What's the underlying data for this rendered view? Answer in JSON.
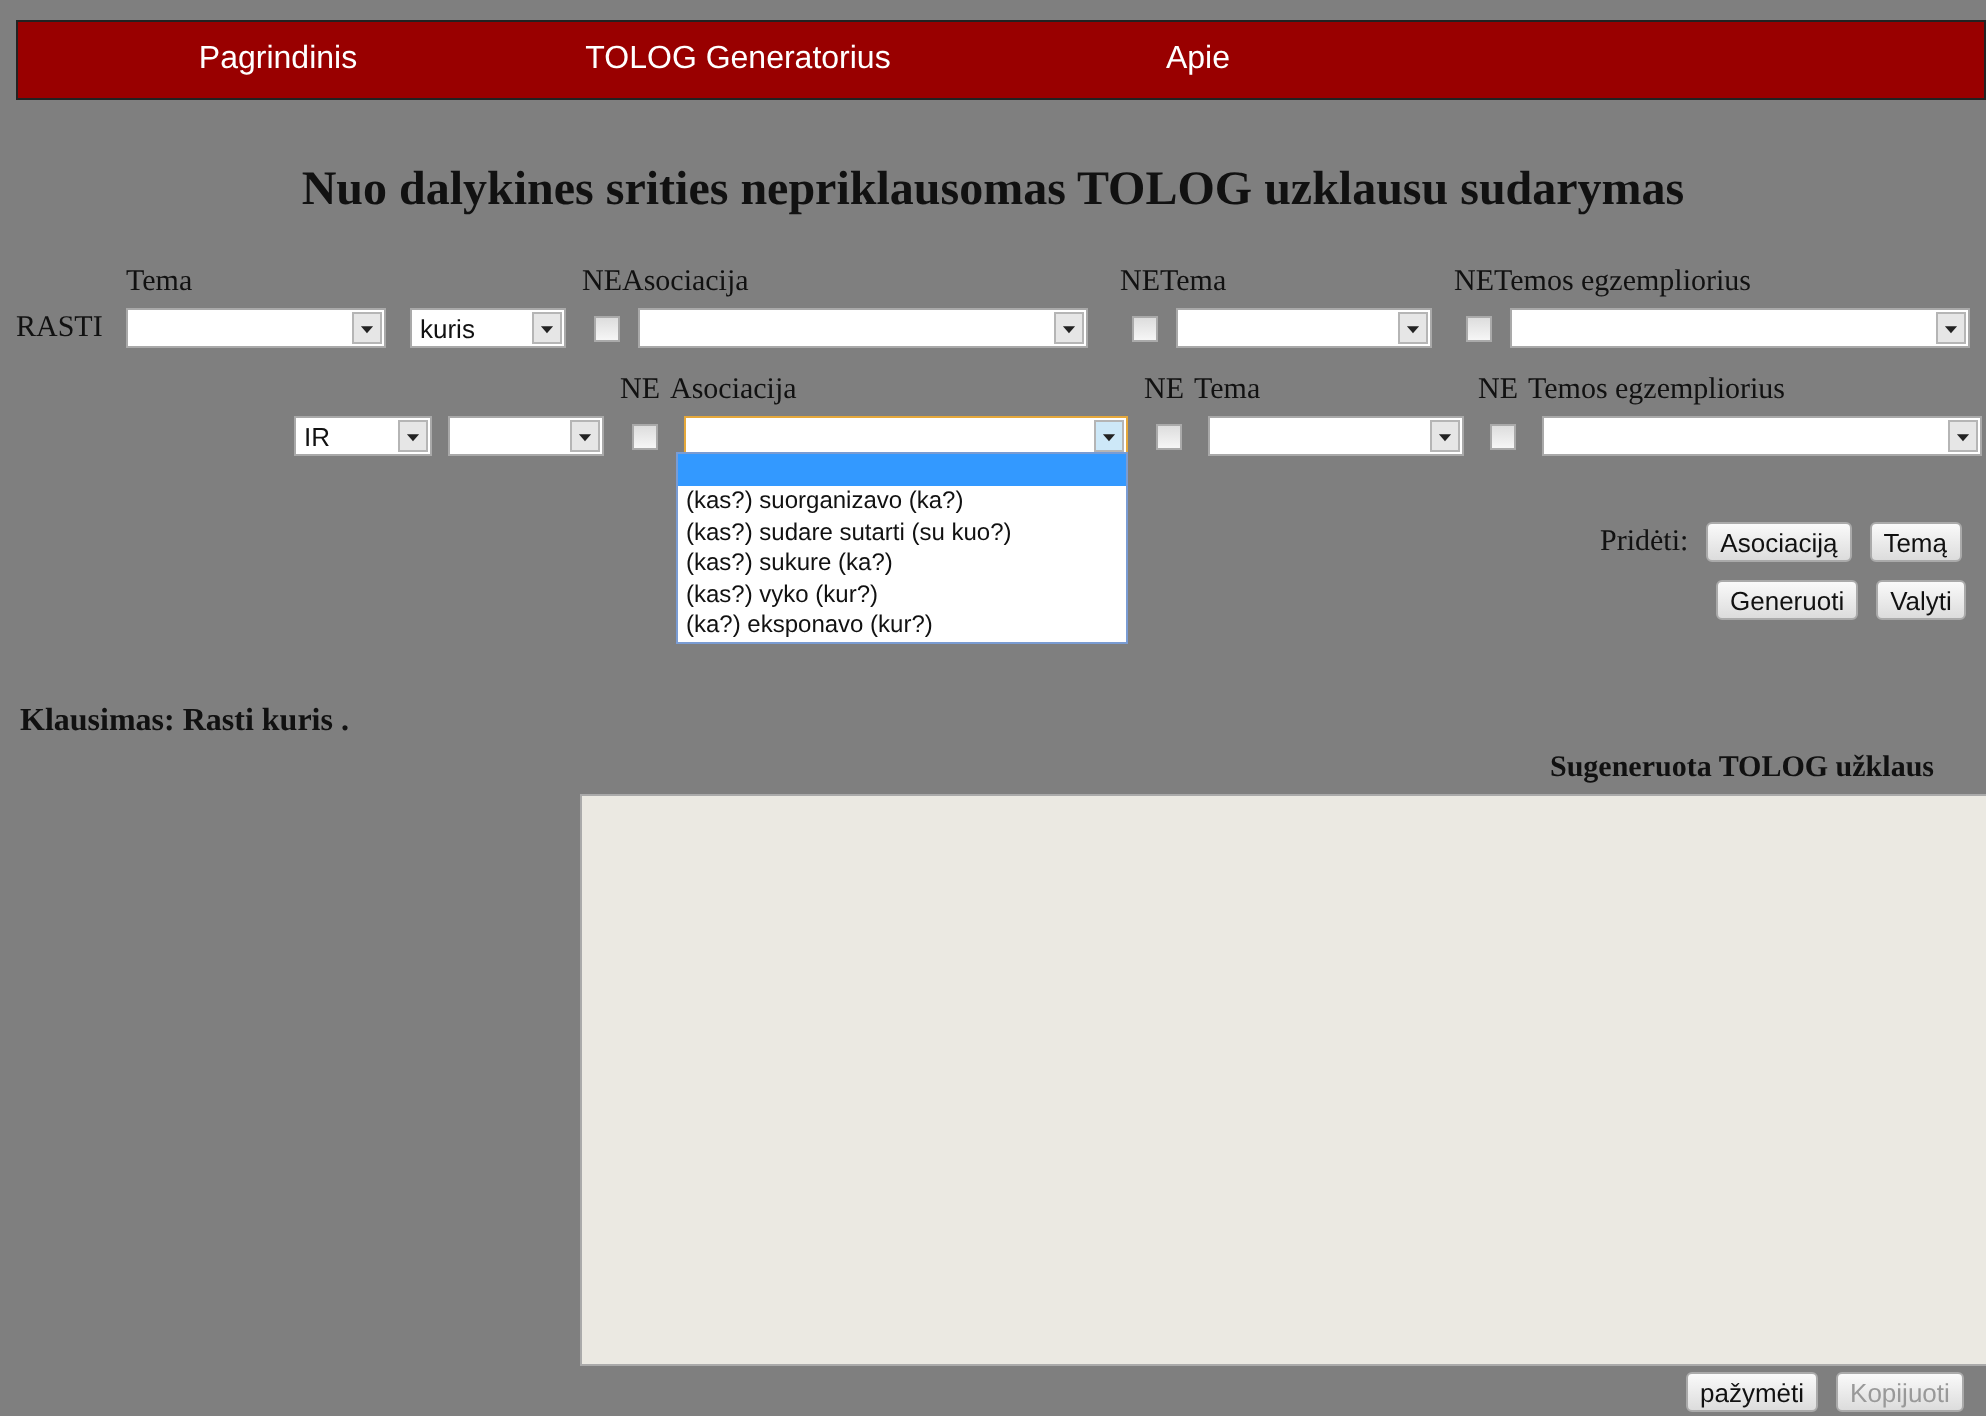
{
  "nav": [
    {
      "label": "Pagrindinis"
    },
    {
      "label": "TOLOG Generatorius"
    },
    {
      "label": "Apie"
    }
  ],
  "heading": "Nuo dalykines srities nepriklausomas TOLOG uzklausu sudarymas",
  "rows": [
    {
      "prefix": "RASTI",
      "items": [
        {
          "kind": "select",
          "label": "Tema"
        },
        {
          "kind": "select",
          "value": "kuris"
        },
        {
          "kind": "negatable",
          "neg_label": "NE",
          "label": "Asociacija",
          "negated": false
        },
        {
          "kind": "negatable",
          "neg_label": "NE",
          "label": "Tema",
          "negated": false
        },
        {
          "kind": "negatable",
          "neg_label": "NE",
          "label": "Temos egzempliorius",
          "negated": false
        }
      ]
    },
    {
      "items": [
        {
          "kind": "select",
          "value": "IR"
        },
        {
          "kind": "select"
        },
        {
          "kind": "negatable",
          "neg_label": "NE",
          "label": "Asociacija",
          "negated": false,
          "focused": true,
          "open": true,
          "blank_highlighted": true,
          "options": [
            "(kas?) suorganizavo (ka?)",
            "(kas?) sudare sutarti (su kuo?)",
            "(kas?) sukure (ka?)",
            "(kas?) vyko (kur?)",
            "(ka?) eksponavo (kur?)"
          ]
        },
        {
          "kind": "negatable",
          "neg_label": "NE",
          "label": "Tema",
          "negated": false
        },
        {
          "kind": "negatable",
          "neg_label": "NE",
          "label": "Temos egzempliorius",
          "negated": false
        }
      ]
    }
  ],
  "add_label": "Pridėti:",
  "add_buttons": [
    "Asociaciją",
    "Temą"
  ],
  "action_buttons": [
    "Generuoti",
    "Valyti"
  ],
  "question": "Klausimas: Rasti kuris .",
  "output_label": "Sugeneruota TOLOG užklaus",
  "output_buttons": [
    {
      "label": "pažymėti",
      "disabled": false
    },
    {
      "label": "Kopijuoti",
      "disabled": true
    }
  ]
}
